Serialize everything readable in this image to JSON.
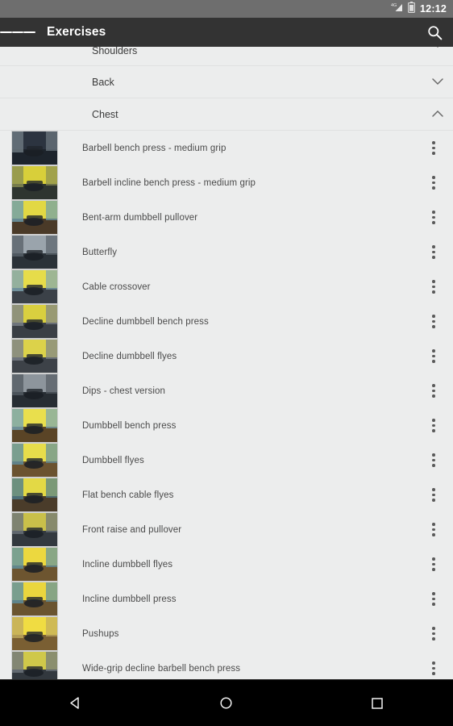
{
  "statusbar": {
    "time": "12:12",
    "icons": [
      "signal-4g-icon",
      "battery-icon"
    ]
  },
  "appbar": {
    "menu_icon": "hamburger-menu-icon",
    "title": "Exercises",
    "search_icon": "search-icon"
  },
  "categories": [
    {
      "label": "Shoulders",
      "state": "collapsed",
      "chevron": "chevron-down-icon",
      "partial": true
    },
    {
      "label": "Back",
      "state": "collapsed",
      "chevron": "chevron-down-icon",
      "highlight": "back"
    },
    {
      "label": "Chest",
      "state": "expanded",
      "chevron": "chevron-up-icon",
      "highlight": "chest"
    }
  ],
  "exercises": [
    {
      "name": "Barbell bench press - medium grip"
    },
    {
      "name": "Barbell incline bench press - medium grip"
    },
    {
      "name": "Bent-arm dumbbell pullover"
    },
    {
      "name": "Butterfly"
    },
    {
      "name": "Cable crossover"
    },
    {
      "name": "Decline dumbbell bench press"
    },
    {
      "name": "Decline dumbbell flyes"
    },
    {
      "name": "Dips - chest version"
    },
    {
      "name": "Dumbbell bench press"
    },
    {
      "name": "Dumbbell flyes"
    },
    {
      "name": "Flat bench cable flyes"
    },
    {
      "name": "Front raise and pullover"
    },
    {
      "name": "Incline dumbbell flyes"
    },
    {
      "name": "Incline dumbbell press"
    },
    {
      "name": "Pushups"
    },
    {
      "name": "Wide-grip decline barbell bench press"
    }
  ],
  "row_menu_icon": "overflow-menu-icon",
  "navbar": {
    "back_icon": "nav-back-icon",
    "home_icon": "nav-home-icon",
    "recents_icon": "nav-recents-icon"
  },
  "colors": {
    "statusbar_bg": "#6e6e6e",
    "appbar_bg": "#333333",
    "page_bg": "#eceded",
    "body_blue": "#3ba9e0",
    "muscle_red": "#ef3d3d",
    "navbar_bg": "#000000"
  }
}
